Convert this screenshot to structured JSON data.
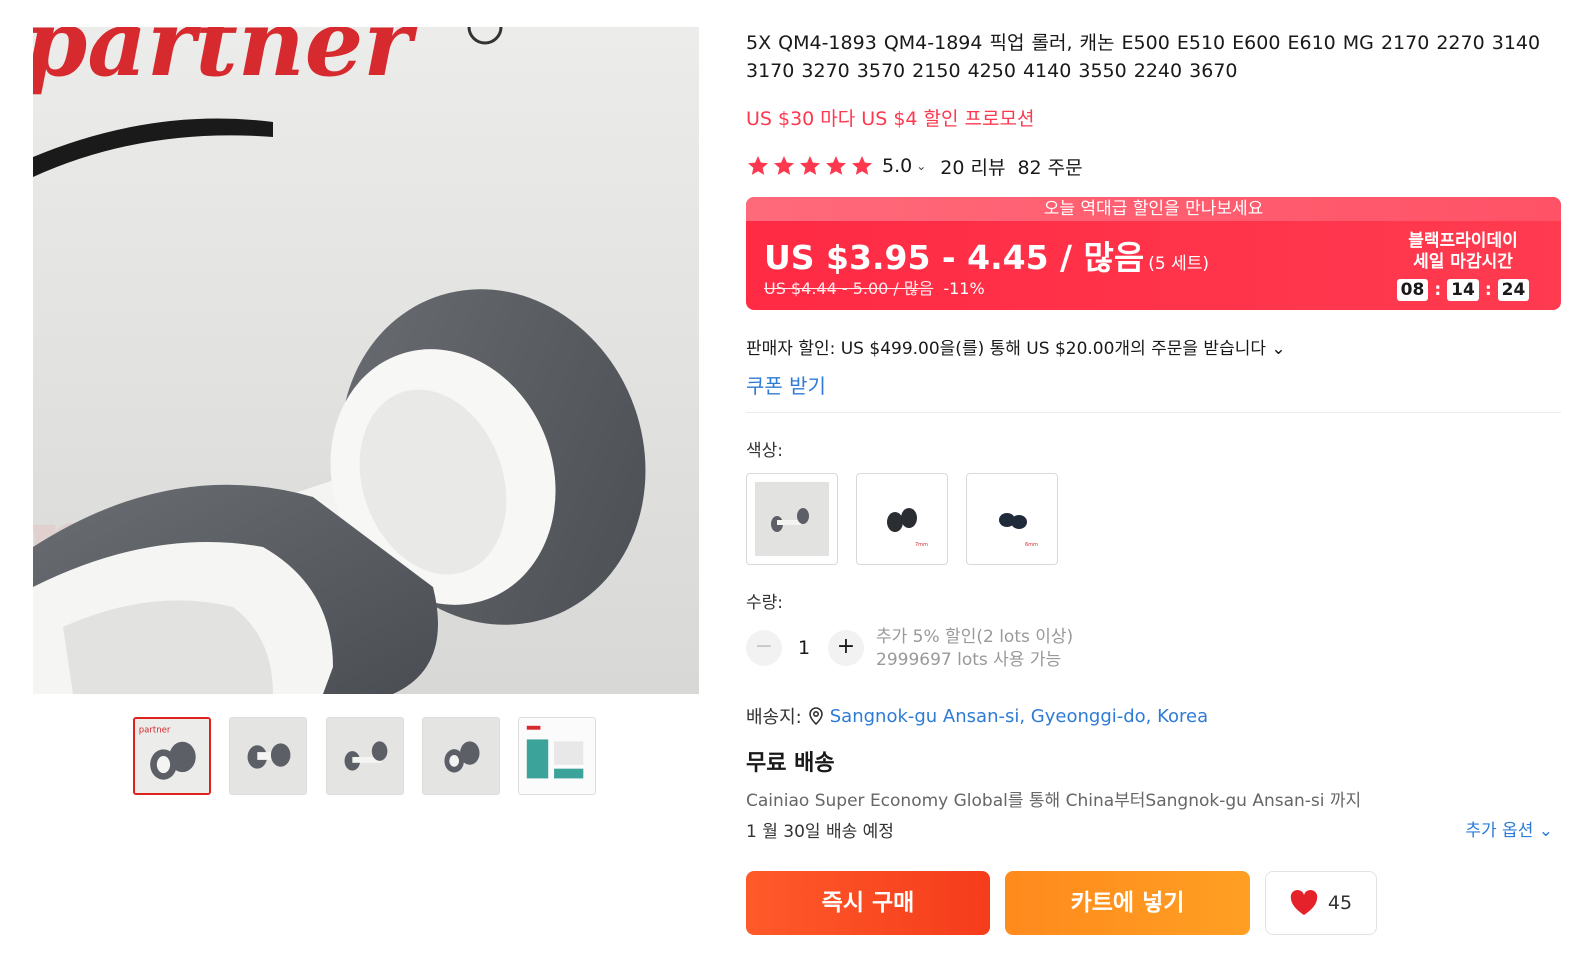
{
  "gallery": {
    "main_watermark": "partner",
    "active_thumb": 0,
    "thumbs": [
      "thumb-1",
      "thumb-2",
      "thumb-3",
      "thumb-4",
      "thumb-5"
    ]
  },
  "product": {
    "title": "5X QM4-1893 QM4-1894 픽업 롤러, 캐논 E500 E510 E600 E610 MG 2170 2270 3140 3170 3270 3570 2150 4250 4140 3550 2240 3670",
    "promo": "US $30 마다 US $4 할인 프로모션",
    "rating": "5.0",
    "rating_chevron": "⌄",
    "reviews": "20 리뷰",
    "orders": "82 주문",
    "star_count": 5,
    "star_color": "#fd384f"
  },
  "price": {
    "banner": "오늘 역대급 할인을 만나보세요",
    "current": "US $3.95 - 4.45 / 많음",
    "unit": "(5 세트)",
    "original": "US $4.44 - 5.00 / 많음",
    "discount": "-11%",
    "countdown_label_1": "블랙프라이데이",
    "countdown_label_2": "세일 마감시간",
    "hh": "08",
    "mm": "14",
    "ss": "24",
    "sep": ":"
  },
  "seller": {
    "discount_text": "판매자 할인: US $499.00을(를) 통해 US $20.00개의 주문을 받습니다 ⌄",
    "coupon_label": "쿠폰 받기"
  },
  "options": {
    "color_label": "색상:",
    "swatches": [
      "roller-set",
      "black-rollers-7mm",
      "black-rollers-6mm"
    ]
  },
  "quantity": {
    "label": "수량:",
    "minus": "−",
    "plus": "+",
    "value": "1",
    "note_1": "추가 5% 할인(2 lots 이상)",
    "note_2": "2999697 lots 사용 가능"
  },
  "shipping": {
    "label": "배송지:",
    "location": "Sangnok-gu Ansan-si, Gyeonggi-do, Korea",
    "free": "무료 배송",
    "via": "Cainiao Super Economy Global를 통해 China부터Sangnok-gu Ansan-si 까지",
    "date": "1 월 30일 배송 예정",
    "more_options": "추가 옵션 ⌄"
  },
  "actions": {
    "buy_now": "즉시 구매",
    "add_to_cart": "카트에 넣기",
    "wishlist_count": "45"
  },
  "colors": {
    "accent_red": "#fd384f",
    "link_blue": "#2e7bd6",
    "buy_orange": "#f53c1b",
    "cart_orange": "#ff9a20"
  }
}
